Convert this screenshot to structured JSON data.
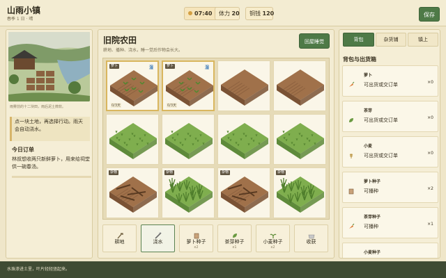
{
  "app": {
    "title": "山雨小镇",
    "subtitle": "春季 1 日 · 晴",
    "time": "07:40",
    "stamina_label": "体力",
    "stamina_value": "20",
    "money_label": "铜钱",
    "money_value": "120",
    "save_label": "保存"
  },
  "left": {
    "scene_caption": "雨雾前的十二块田，雨后泥土微软。",
    "tip": "点一块土地，再选择行动。雨天会自动浇水。",
    "order_title": "今日订单",
    "order_text": "林叔想收两只新鲜萝卜，用来给祠堂供一碗春汤。"
  },
  "field": {
    "title": "旧院农田",
    "subtitle": "耕地、播种、浇水，睡一觉后作物会长大。",
    "sleep_label": "回屋睡觉",
    "plots": [
      {
        "state": "sprout",
        "tag": "萝卜",
        "water": "湿",
        "days": "0/3天",
        "selected": true
      },
      {
        "state": "sprout",
        "tag": "萝卜",
        "water": "湿",
        "days": "0/3天",
        "selected": true
      },
      {
        "state": "tilled",
        "tag": "",
        "water": "",
        "days": "",
        "selected": false
      },
      {
        "state": "tilled",
        "tag": "",
        "water": "",
        "days": "",
        "selected": false
      },
      {
        "state": "grass",
        "tag": "",
        "water": "",
        "days": "",
        "selected": false
      },
      {
        "state": "grass",
        "tag": "",
        "water": "",
        "days": "",
        "selected": false
      },
      {
        "state": "grass",
        "tag": "",
        "water": "",
        "days": "",
        "selected": false
      },
      {
        "state": "grass",
        "tag": "",
        "water": "",
        "days": "",
        "selected": false
      },
      {
        "state": "debris",
        "tag": "杂物",
        "water": "",
        "days": "",
        "selected": false
      },
      {
        "state": "weeds",
        "tag": "杂物",
        "water": "",
        "days": "",
        "selected": false
      },
      {
        "state": "debris",
        "tag": "杂物",
        "water": "",
        "days": "",
        "selected": false
      },
      {
        "state": "weeds",
        "tag": "杂物",
        "water": "",
        "days": "",
        "selected": false
      }
    ],
    "tools": [
      {
        "label": "耕地",
        "count": "",
        "icon": "hoe-icon",
        "active": false
      },
      {
        "label": "浇水",
        "count": "",
        "icon": "watering-can-icon",
        "active": true
      },
      {
        "label": "萝卜种子",
        "count": "x2",
        "icon": "seed-bag-icon",
        "active": false
      },
      {
        "label": "茶芽种子",
        "count": "x1",
        "icon": "leaf-icon",
        "active": false
      },
      {
        "label": "小麦种子",
        "count": "x2",
        "icon": "sprout-icon",
        "active": false
      },
      {
        "label": "收获",
        "count": "",
        "icon": "basket-icon",
        "active": false
      }
    ]
  },
  "right": {
    "tabs": [
      "背包",
      "杂货铺",
      "镇上"
    ],
    "inventory_title": "背包与出货箱",
    "items": [
      {
        "name": "萝卜",
        "desc": "可出货或交订单",
        "qty": "×0",
        "icon": "carrot-icon"
      },
      {
        "name": "茶芽",
        "desc": "可出货或交订单",
        "qty": "×0",
        "icon": "leaf-icon"
      },
      {
        "name": "小麦",
        "desc": "可出货或交订单",
        "qty": "×0",
        "icon": "wheat-icon"
      },
      {
        "name": "萝卜种子",
        "desc": "可播种",
        "qty": "×2",
        "icon": "seed-bag-icon"
      },
      {
        "name": "茶芽种子",
        "desc": "可播种",
        "qty": "×1",
        "icon": "carrot-icon"
      },
      {
        "name": "小麦种子",
        "desc": "",
        "qty": "",
        "icon": "wheat-icon"
      }
    ]
  },
  "status": "水珠渗进土里，叶片轻轻竖起来。",
  "colors": {
    "accent": "#4e7a47",
    "soil": "#a0714a",
    "grass": "#7fae4e",
    "selected": "#d9b65e"
  }
}
